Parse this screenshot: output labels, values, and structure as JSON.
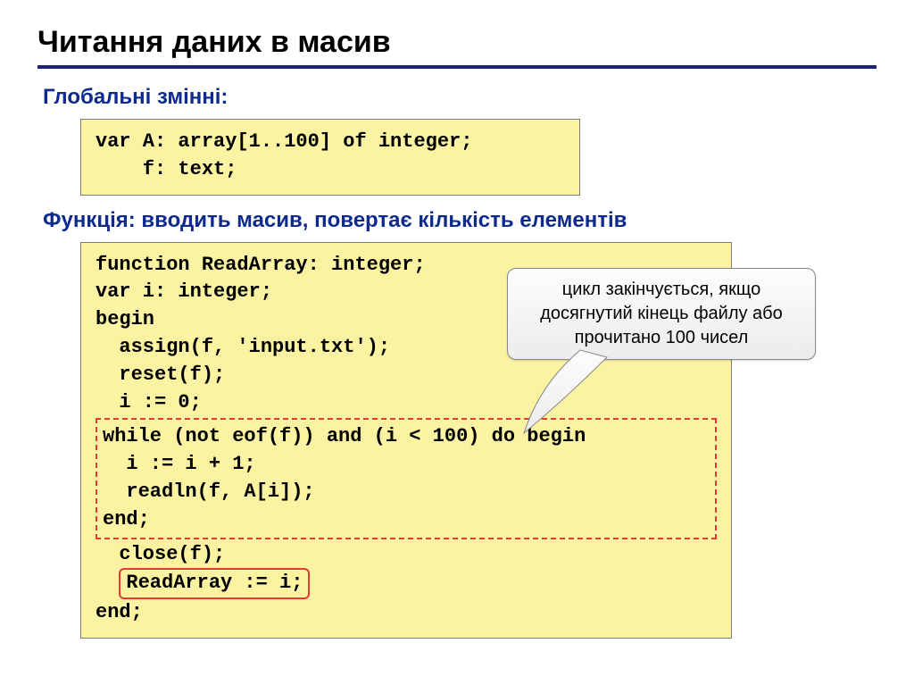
{
  "title": "Читання даних в масив",
  "sub1": "Глобальні змінні:",
  "decl": "var A: array[1..100] of integer;\n    f: text;",
  "sub2": "Функція: вводить масив, повертає кількість елементів",
  "func_pre": "function ReadArray: integer;\nvar i: integer;\nbegin\n  assign(f, 'input.txt');\n  reset(f);\n  i := 0;",
  "func_while": "while (not eof(f)) and (i < 100) do begin\n  i := i + 1;\n  readln(f, A[i]);\nend;",
  "func_close": "  close(f);",
  "func_return": "ReadArray := i;",
  "func_end": "end;",
  "callout": "цикл закінчується, якщо досягнутий кінець файлу або прочитано 100 чисел"
}
